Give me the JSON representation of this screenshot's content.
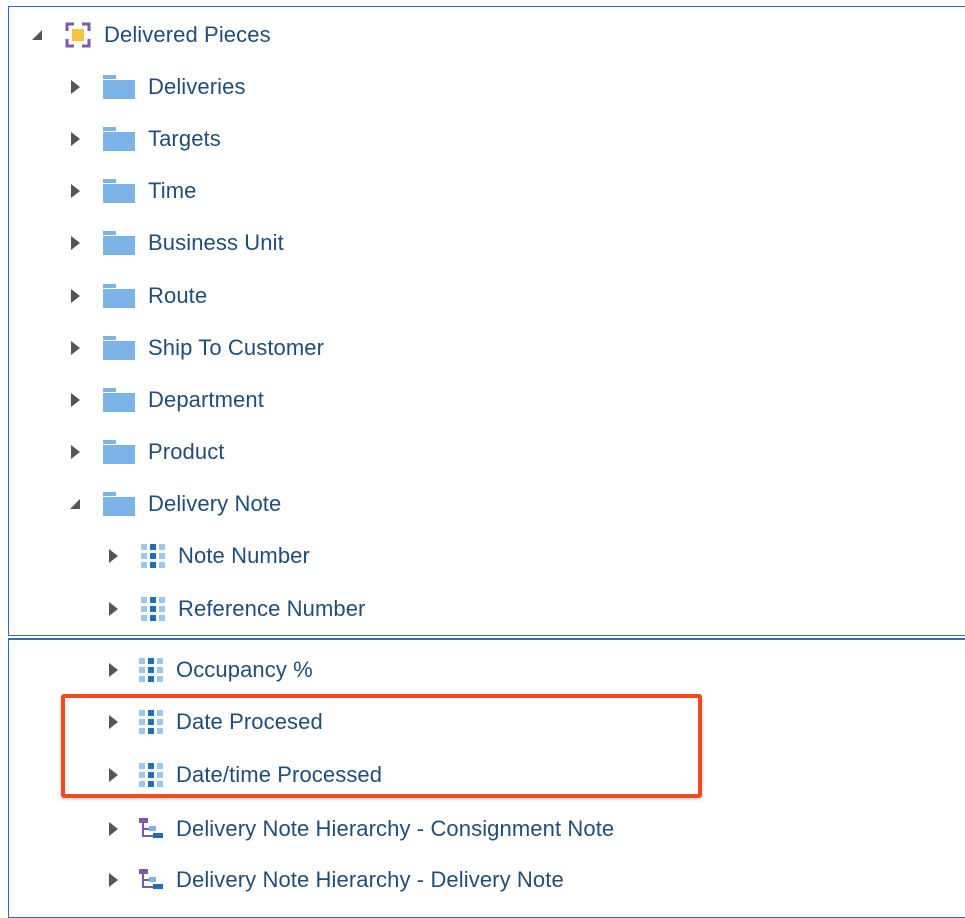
{
  "tree_top": {
    "root": {
      "label": "Delivered Pieces",
      "icon": "subject-area-icon",
      "expanded": true
    },
    "folders": [
      {
        "label": "Deliveries",
        "icon": "folder-icon",
        "expanded": false
      },
      {
        "label": "Targets",
        "icon": "folder-icon",
        "expanded": false
      },
      {
        "label": "Time",
        "icon": "folder-icon",
        "expanded": false
      },
      {
        "label": "Business Unit",
        "icon": "folder-icon",
        "expanded": false
      },
      {
        "label": "Route",
        "icon": "folder-icon",
        "expanded": false
      },
      {
        "label": "Ship To Customer",
        "icon": "folder-icon",
        "expanded": false
      },
      {
        "label": "Department",
        "icon": "folder-icon",
        "expanded": false
      },
      {
        "label": "Product",
        "icon": "folder-icon",
        "expanded": false
      },
      {
        "label": "Delivery Note",
        "icon": "folder-icon",
        "expanded": true
      }
    ],
    "children": [
      {
        "label": "Note Number",
        "icon": "attribute-grid-icon"
      },
      {
        "label": "Reference Number",
        "icon": "attribute-grid-icon"
      }
    ]
  },
  "tree_bottom": {
    "children": [
      {
        "label": "Occupancy %",
        "icon": "attribute-grid-icon"
      },
      {
        "label": "Date Procesed",
        "icon": "attribute-grid-icon",
        "highlighted": true
      },
      {
        "label": "Date/time Processed",
        "icon": "attribute-grid-icon",
        "highlighted": true
      },
      {
        "label": "Delivery Note Hierarchy - Consignment Note",
        "icon": "hierarchy-icon"
      },
      {
        "label": "Delivery Note Hierarchy - Delivery Note",
        "icon": "hierarchy-icon"
      }
    ]
  },
  "colors": {
    "label_text": "#1f4e79",
    "folder": "#7cb4e8",
    "highlight_border": "#f04a1f",
    "panel_border": "#2f6fb8"
  }
}
